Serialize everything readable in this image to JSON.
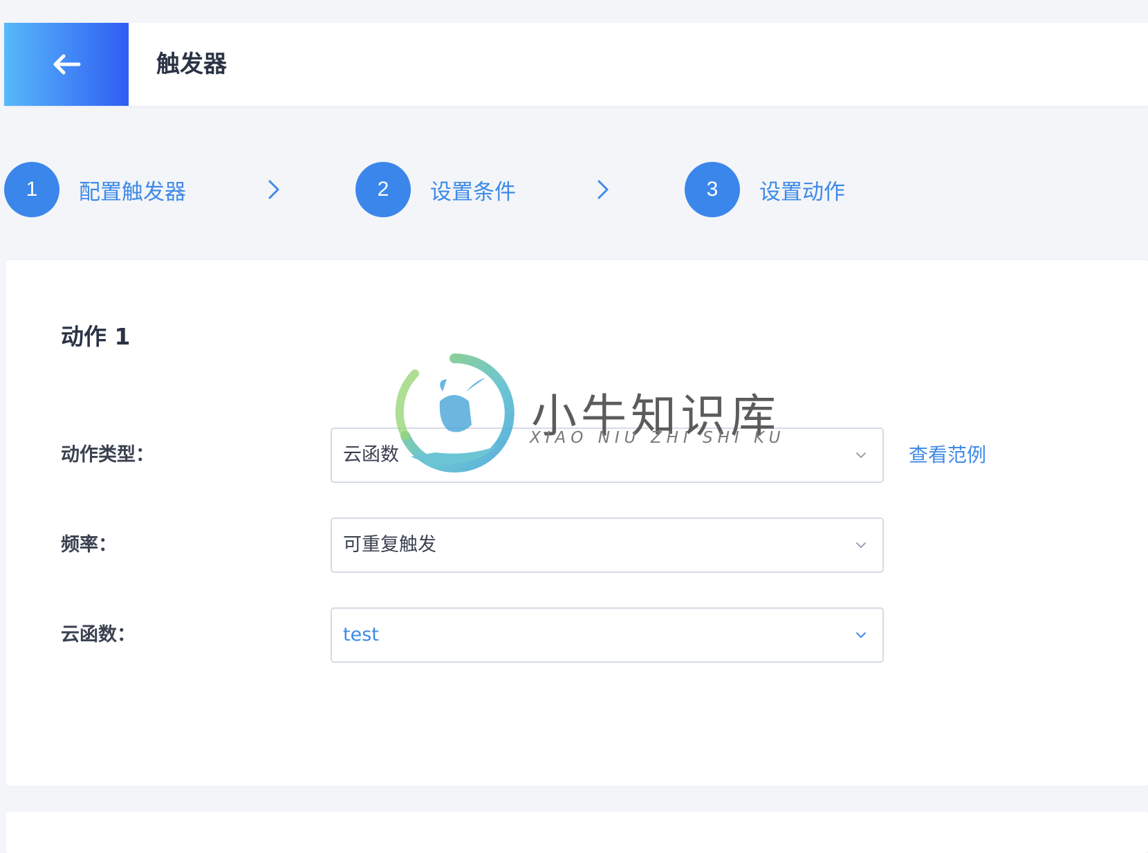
{
  "header": {
    "title": "触发器"
  },
  "steps": [
    {
      "number": "1",
      "label": "配置触发器"
    },
    {
      "number": "2",
      "label": "设置条件"
    },
    {
      "number": "3",
      "label": "设置动作"
    }
  ],
  "action": {
    "title": "动作 1",
    "fields": [
      {
        "label": "动作类型：",
        "value": "云函数"
      },
      {
        "label": "频率：",
        "value": "可重复触发"
      },
      {
        "label": "云函数：",
        "value": "test"
      }
    ],
    "example_link": "查看范例"
  },
  "watermark": {
    "text": "小牛知识库",
    "subtext": "XIAO NIU ZHI SHI KU"
  },
  "colors": {
    "accent": "#3b86ea",
    "link": "#3f8ae6",
    "background": "#f3f5f9",
    "header_gradient_start": "#57b9fa",
    "header_gradient_end": "#2f5df3"
  },
  "icons": {
    "back": "arrow-left-icon",
    "step_separator": "chevron-right-icon",
    "select": "chevron-down-icon"
  }
}
